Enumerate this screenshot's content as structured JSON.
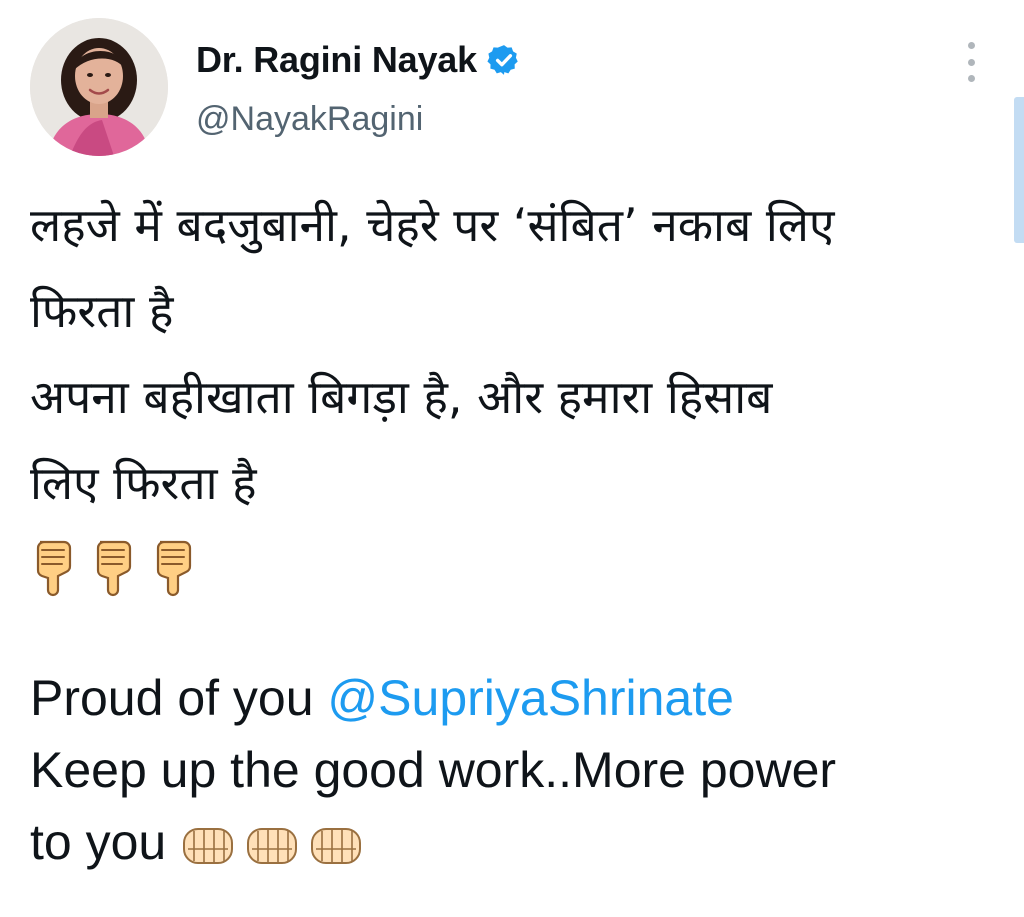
{
  "author": {
    "display_name": "Dr. Ragini Nayak",
    "handle": "@NayakRagini",
    "verified": true,
    "avatar_icon": "profile-photo"
  },
  "tweet": {
    "hindi_lines": [
      "लहजे में बदजुबानी, चेहरे पर ‘संबित’ नकाब लिए",
      "फिरता है",
      "अपना बहीखाता बिगड़ा है, और हमारा हिसाब",
      "लिए फिरता है"
    ],
    "reaction_emojis": [
      "thumbs-down-icon",
      "thumbs-down-icon",
      "thumbs-down-icon"
    ],
    "english_intro": "Proud of you ",
    "mention": "@SupriyaShrinate",
    "english_line2": "Keep up the good work..More power",
    "english_line3": "to you",
    "closing_emojis": [
      "fist-bump-icon",
      "fist-bump-icon",
      "fist-bump-icon"
    ]
  },
  "colors": {
    "link": "#1d9bf0",
    "verified_badge": "#1d9bf0",
    "handle_gray": "#536471",
    "text": "#0f1419"
  }
}
